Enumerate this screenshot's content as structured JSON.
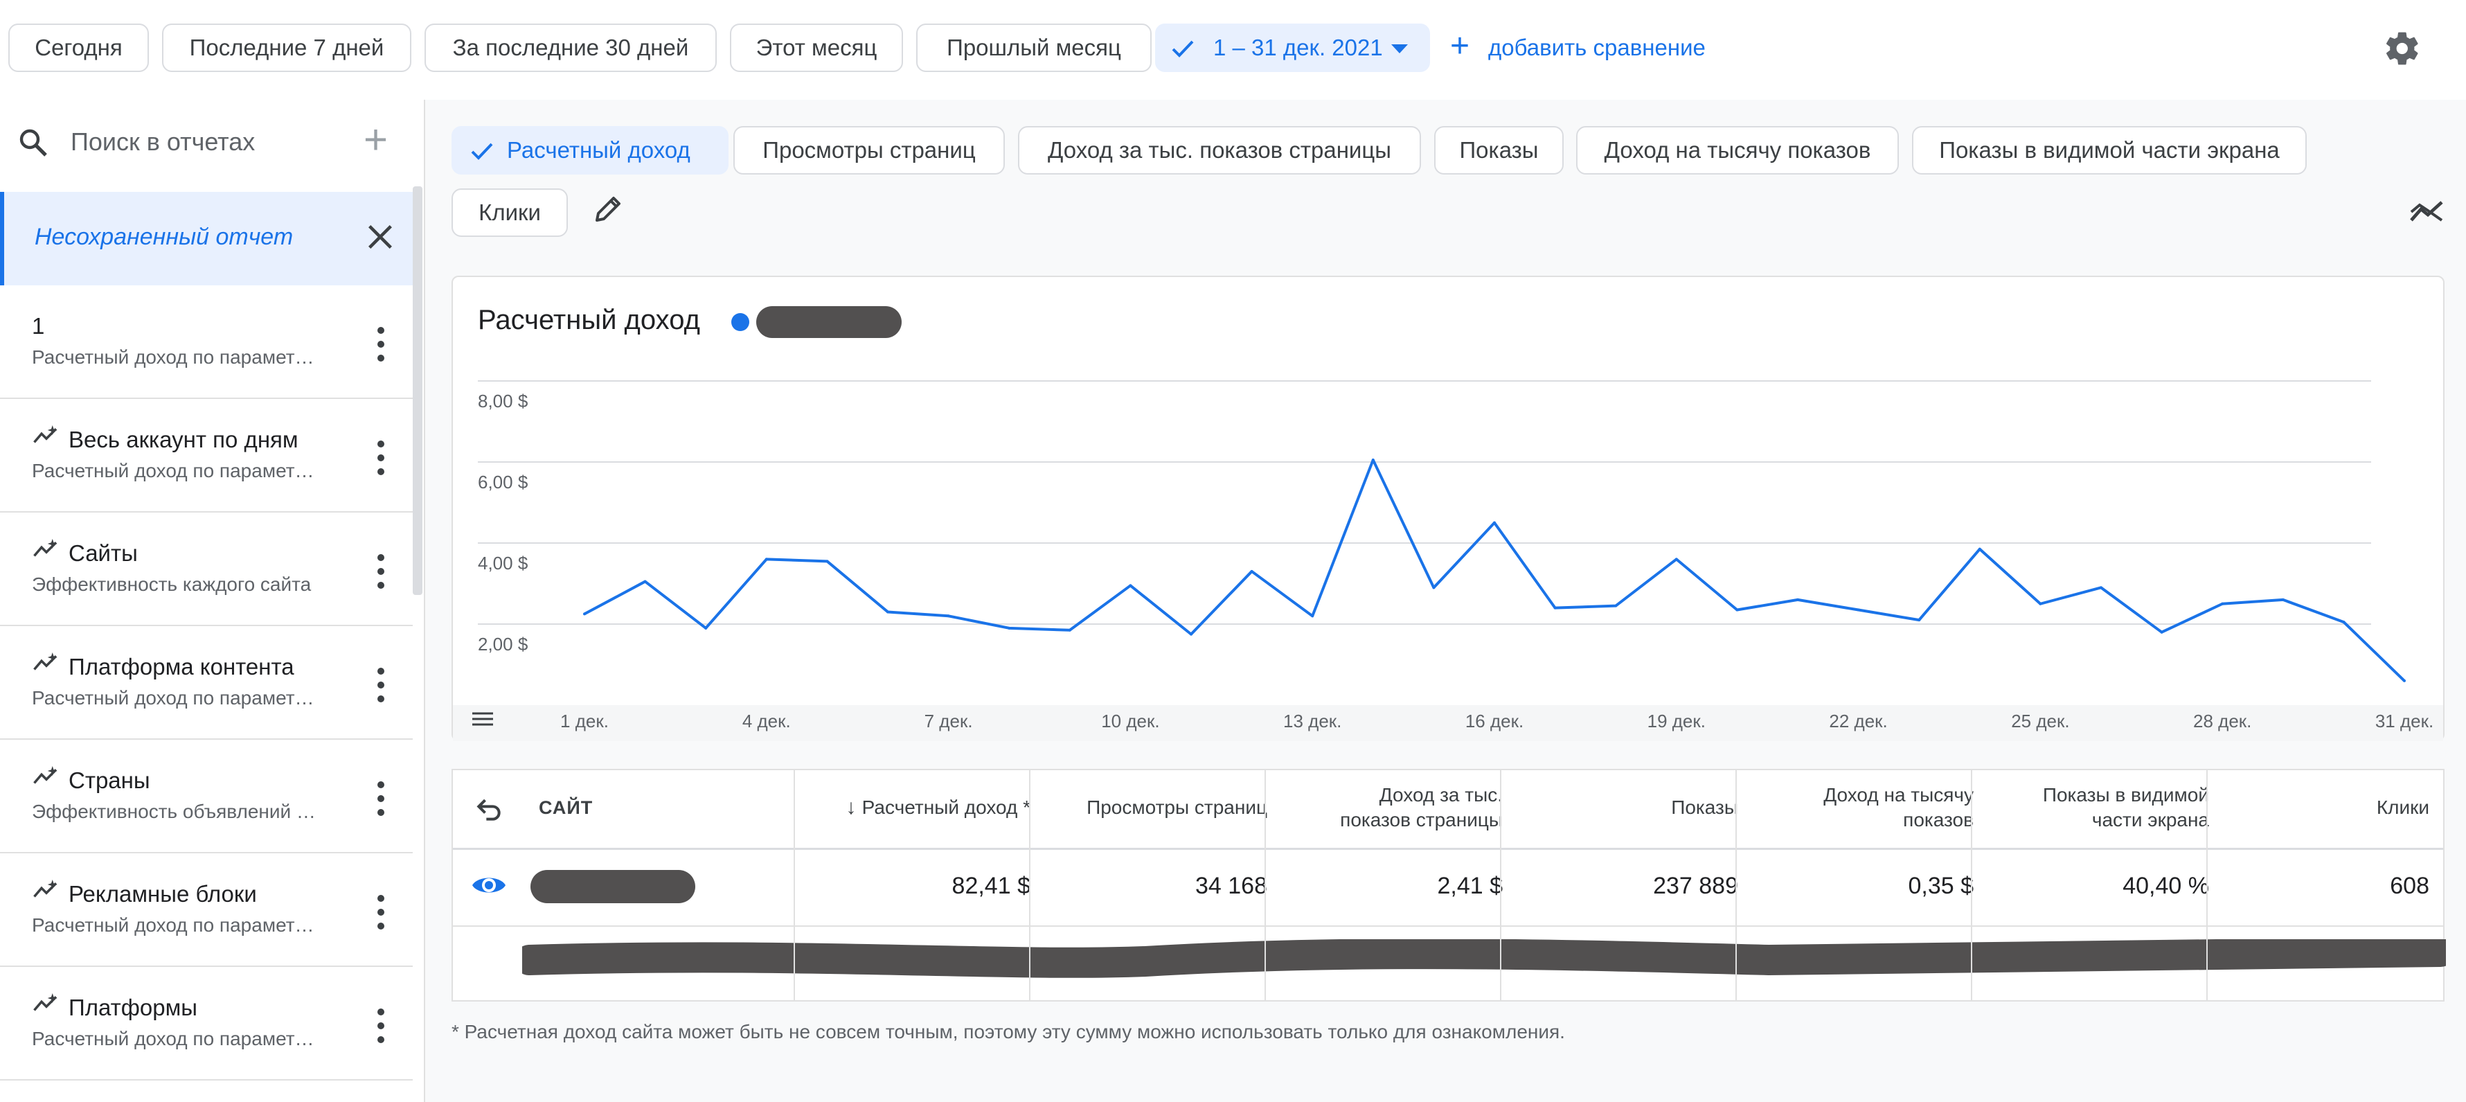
{
  "date_range": {
    "presets": [
      "Сегодня",
      "Последние 7 дней",
      "За последние 30 дней",
      "Этот месяц",
      "Прошлый месяц"
    ],
    "selected": "1 – 31 дек. 2021",
    "add_compare": "добавить сравнение"
  },
  "sidebar": {
    "search_placeholder": "Поиск в отчетах",
    "unsaved_report": "Несохраненный отчет",
    "reports": [
      {
        "title": "1",
        "subtitle": "Расчетный доход по парамет…",
        "icon": ""
      },
      {
        "title": "Весь аккаунт по дням",
        "subtitle": "Расчетный доход по парамет…",
        "icon": "auto-report-icon"
      },
      {
        "title": "Сайты",
        "subtitle": "Эффективность каждого сайта",
        "icon": "auto-report-icon"
      },
      {
        "title": "Платформа контента",
        "subtitle": "Расчетный доход по парамет…",
        "icon": "auto-report-icon"
      },
      {
        "title": "Страны",
        "subtitle": "Эффективность объявлений …",
        "icon": "auto-report-icon"
      },
      {
        "title": "Рекламные блоки",
        "subtitle": "Расчетный доход по парамет…",
        "icon": "auto-report-icon"
      },
      {
        "title": "Платформы",
        "subtitle": "Расчетный доход по парамет…",
        "icon": "auto-report-icon"
      }
    ]
  },
  "metrics": {
    "chips": [
      "Расчетный доход",
      "Просмотры страниц",
      "Доход за тыс. показов страницы",
      "Показы",
      "Доход на тысячу показов",
      "Показы в видимой части экрана",
      "Клики"
    ],
    "active": "Расчетный доход"
  },
  "chart": {
    "title": "Расчетный доход",
    "series_color": "#1a73e8"
  },
  "chart_data": {
    "type": "line",
    "x_ticks": [
      "1 дек.",
      "4 дек.",
      "7 дек.",
      "10 дек.",
      "13 дек.",
      "16 дек.",
      "19 дек.",
      "22 дек.",
      "25 дек.",
      "28 дек.",
      "31 дек."
    ],
    "y_ticks": [
      "2,00 $",
      "4,00 $",
      "6,00 $",
      "8,00 $"
    ],
    "ylim": [
      0,
      8
    ],
    "x": [
      1,
      2,
      3,
      4,
      5,
      6,
      7,
      8,
      9,
      10,
      11,
      12,
      13,
      14,
      15,
      16,
      17,
      18,
      19,
      20,
      21,
      22,
      23,
      24,
      25,
      26,
      27,
      28,
      29,
      30,
      31
    ],
    "values": [
      2.25,
      3.05,
      1.9,
      3.6,
      3.55,
      2.3,
      2.2,
      1.9,
      1.85,
      2.95,
      1.75,
      3.3,
      2.2,
      6.05,
      2.9,
      4.5,
      2.4,
      2.45,
      3.6,
      2.35,
      2.6,
      2.35,
      2.1,
      3.85,
      2.5,
      2.9,
      1.8,
      2.5,
      2.6,
      2.05,
      0.6
    ]
  },
  "table": {
    "headers": {
      "site": "САЙТ",
      "revenue": "Расчетный доход *",
      "pageviews": "Просмотры страниц",
      "page_rpm": [
        "Доход за тыс.",
        "показов страницы"
      ],
      "impressions": "Показы",
      "rpm": [
        "Доход на тысячу",
        "показов"
      ],
      "viewable": [
        "Показы в видимой",
        "части экрана"
      ],
      "clicks": "Клики"
    },
    "row": {
      "revenue": "82,41 $",
      "pageviews": "34 168",
      "page_rpm": "2,41 $",
      "impressions": "237 889",
      "rpm": "0,35 $",
      "viewable": "40,40 %",
      "clicks": "608"
    },
    "footnote": "* Расчетная доход сайта может быть не совсем точным, поэтому эту сумму можно использовать только для ознакомления."
  }
}
